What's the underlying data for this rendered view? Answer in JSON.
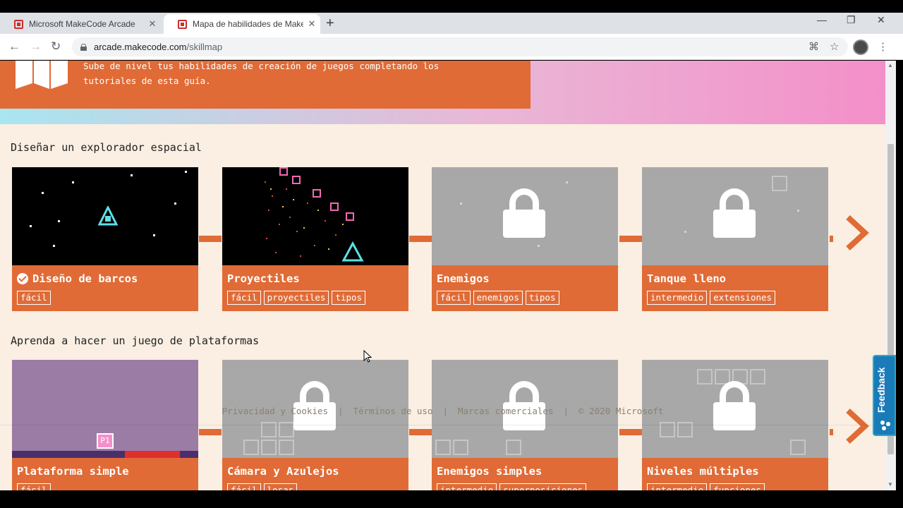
{
  "browser": {
    "tabs": [
      {
        "title": "Microsoft MakeCode Arcade",
        "active": false
      },
      {
        "title": "Mapa de habilidades de MakeCo",
        "active": true
      }
    ],
    "url_host": "arcade.makecode.com",
    "url_path": "/skillmap",
    "window_controls": [
      "minimize",
      "restore",
      "close"
    ]
  },
  "banner": {
    "text": "Sube de nivel tus habilidades de creación de juegos completando los tutoriales de esta guía."
  },
  "sections": [
    {
      "title": "Diseñar un explorador espacial",
      "cards": [
        {
          "title": "Diseño de barcos",
          "completed": true,
          "locked": false,
          "tags": [
            "fácil"
          ]
        },
        {
          "title": "Proyectiles",
          "completed": false,
          "locked": false,
          "tags": [
            "fácil",
            "proyectiles",
            "tipos"
          ]
        },
        {
          "title": "Enemigos",
          "completed": false,
          "locked": true,
          "tags": [
            "fácil",
            "enemigos",
            "tipos"
          ]
        },
        {
          "title": "Tanque lleno",
          "completed": false,
          "locked": true,
          "tags": [
            "intermedio",
            "extensiones"
          ]
        }
      ]
    },
    {
      "title": "Aprenda a hacer un juego de plataformas",
      "cards": [
        {
          "title": "Plataforma simple",
          "completed": false,
          "locked": false,
          "tags": [
            "fácil"
          ]
        },
        {
          "title": "Cámara y Azulejos",
          "completed": false,
          "locked": true,
          "tags": [
            "fácil",
            "losas"
          ]
        },
        {
          "title": "Enemigos simples",
          "completed": false,
          "locked": true,
          "tags": [
            "intermedio",
            "superposiciones"
          ]
        },
        {
          "title": "Niveles múltiples",
          "completed": false,
          "locked": true,
          "tags": [
            "intermedio",
            "funciones"
          ]
        }
      ]
    }
  ],
  "footer": {
    "privacy": "Privacidad y Cookies",
    "terms": "Términos de uso",
    "trademarks": "Marcas comerciales",
    "copyright": "© 2020 Microsoft"
  },
  "feedback_label": "Feedback",
  "sprite_label": "P1",
  "colors": {
    "accent": "#e06b36",
    "page_bg": "#faefe2",
    "locked": "#a8a8a8"
  }
}
